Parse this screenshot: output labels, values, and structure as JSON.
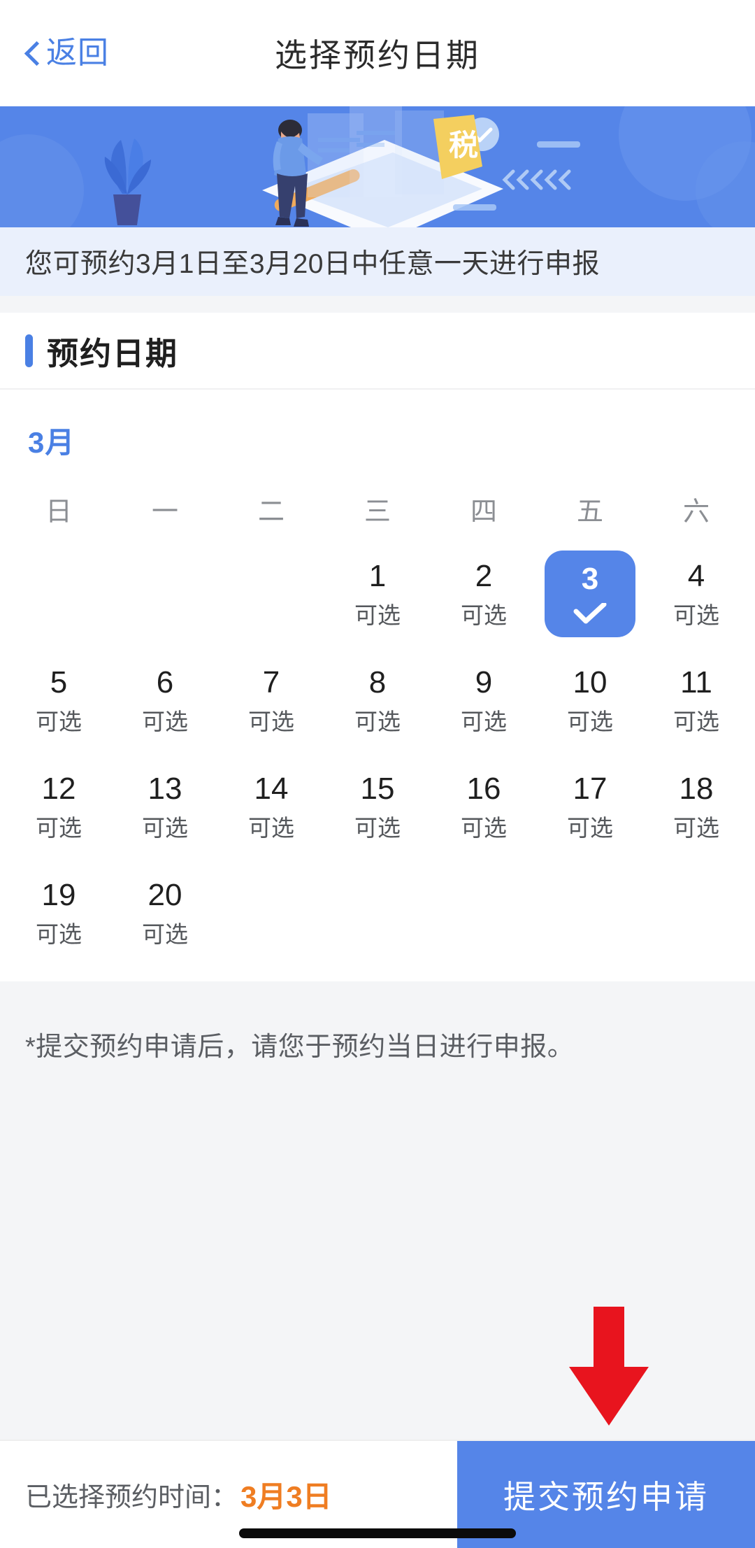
{
  "header": {
    "back_label": "返回",
    "back_icon": "chevron-left-icon",
    "title": "选择预约日期"
  },
  "banner": {
    "tax_tag": "税",
    "arrows_decor": "<<<<",
    "background_color": "#5585E8"
  },
  "info_strip": {
    "text": "您可预约3月1日至3月20日中任意一天进行申报",
    "background_color": "#EAF0FC"
  },
  "section": {
    "title": "预约日期",
    "accent_color": "#4A80E4"
  },
  "calendar": {
    "month_label": "3月",
    "weekday_headers": [
      "日",
      "一",
      "二",
      "三",
      "四",
      "五",
      "六"
    ],
    "selectable_text": "可选",
    "selected_day": "3",
    "selected_color": "#5585E8",
    "weeks": [
      [
        {
          "day": "",
          "status": "",
          "state": "empty"
        },
        {
          "day": "",
          "status": "",
          "state": "empty"
        },
        {
          "day": "",
          "status": "",
          "state": "empty"
        },
        {
          "day": "1",
          "status": "可选",
          "state": "available"
        },
        {
          "day": "2",
          "status": "可选",
          "state": "available"
        },
        {
          "day": "3",
          "status": "",
          "state": "selected"
        },
        {
          "day": "4",
          "status": "可选",
          "state": "available"
        }
      ],
      [
        {
          "day": "5",
          "status": "可选",
          "state": "available"
        },
        {
          "day": "6",
          "status": "可选",
          "state": "available"
        },
        {
          "day": "7",
          "status": "可选",
          "state": "available"
        },
        {
          "day": "8",
          "status": "可选",
          "state": "available"
        },
        {
          "day": "9",
          "status": "可选",
          "state": "available"
        },
        {
          "day": "10",
          "status": "可选",
          "state": "available"
        },
        {
          "day": "11",
          "status": "可选",
          "state": "available"
        }
      ],
      [
        {
          "day": "12",
          "status": "可选",
          "state": "available"
        },
        {
          "day": "13",
          "status": "可选",
          "state": "available"
        },
        {
          "day": "14",
          "status": "可选",
          "state": "available"
        },
        {
          "day": "15",
          "status": "可选",
          "state": "available"
        },
        {
          "day": "16",
          "status": "可选",
          "state": "available"
        },
        {
          "day": "17",
          "status": "可选",
          "state": "available"
        },
        {
          "day": "18",
          "status": "可选",
          "state": "available"
        }
      ],
      [
        {
          "day": "19",
          "status": "可选",
          "state": "available"
        },
        {
          "day": "20",
          "status": "可选",
          "state": "available"
        },
        {
          "day": "",
          "status": "",
          "state": "empty"
        },
        {
          "day": "",
          "status": "",
          "state": "empty"
        },
        {
          "day": "",
          "status": "",
          "state": "empty"
        },
        {
          "day": "",
          "status": "",
          "state": "empty"
        },
        {
          "day": "",
          "status": "",
          "state": "empty"
        }
      ]
    ]
  },
  "note": {
    "text": "*提交预约申请后，请您于预约当日进行申报。"
  },
  "annotation": {
    "arrow_color": "#E8141E",
    "arrow_direction": "down"
  },
  "bottom_bar": {
    "selected_label": "已选择预约时间：",
    "selected_value": "3月3日",
    "selected_value_color": "#EF7D22",
    "submit_label": "提交预约申请",
    "submit_color": "#5585E8"
  }
}
